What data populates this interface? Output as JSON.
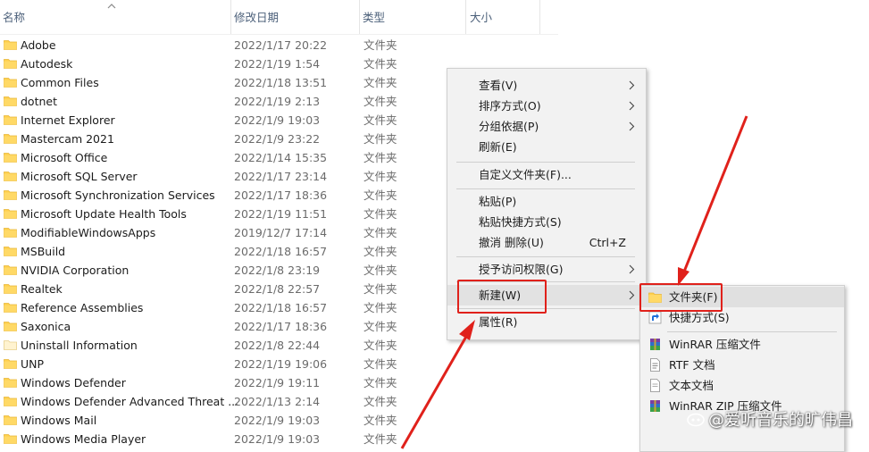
{
  "columns": {
    "name": "名称",
    "date": "修改日期",
    "type": "类型",
    "size": "大小"
  },
  "files": [
    {
      "name": "Adobe",
      "date": "2022/1/17 20:22",
      "type": "文件夹"
    },
    {
      "name": "Autodesk",
      "date": "2022/1/19 1:54",
      "type": "文件夹"
    },
    {
      "name": "Common Files",
      "date": "2022/1/18 13:51",
      "type": "文件夹"
    },
    {
      "name": "dotnet",
      "date": "2022/1/19 2:13",
      "type": "文件夹"
    },
    {
      "name": "Internet Explorer",
      "date": "2022/1/9 19:03",
      "type": "文件夹"
    },
    {
      "name": "Mastercam 2021",
      "date": "2022/1/9 23:22",
      "type": "文件夹"
    },
    {
      "name": "Microsoft Office",
      "date": "2022/1/14 15:35",
      "type": "文件夹"
    },
    {
      "name": "Microsoft SQL Server",
      "date": "2022/1/17 23:14",
      "type": "文件夹"
    },
    {
      "name": "Microsoft Synchronization Services",
      "date": "2022/1/17 18:36",
      "type": "文件夹"
    },
    {
      "name": "Microsoft Update Health Tools",
      "date": "2022/1/19 11:51",
      "type": "文件夹"
    },
    {
      "name": "ModifiableWindowsApps",
      "date": "2019/12/7 17:14",
      "type": "文件夹"
    },
    {
      "name": "MSBuild",
      "date": "2022/1/18 16:57",
      "type": "文件夹"
    },
    {
      "name": "NVIDIA Corporation",
      "date": "2022/1/8 23:19",
      "type": "文件夹"
    },
    {
      "name": "Realtek",
      "date": "2022/1/8 22:57",
      "type": "文件夹"
    },
    {
      "name": "Reference Assemblies",
      "date": "2022/1/18 16:57",
      "type": "文件夹"
    },
    {
      "name": "Saxonica",
      "date": "2022/1/17 18:36",
      "type": "文件夹"
    },
    {
      "name": "Uninstall Information",
      "date": "2022/1/8 22:44",
      "type": "文件夹"
    },
    {
      "name": "UNP",
      "date": "2022/1/19 19:06",
      "type": "文件夹"
    },
    {
      "name": "Windows Defender",
      "date": "2022/1/9 19:11",
      "type": "文件夹"
    },
    {
      "name": "Windows Defender Advanced Threat ...",
      "date": "2022/1/13 2:14",
      "type": "文件夹"
    },
    {
      "name": "Windows Mail",
      "date": "2022/1/9 19:03",
      "type": "文件夹"
    },
    {
      "name": "Windows Media Player",
      "date": "2022/1/9 19:03",
      "type": "文件夹"
    }
  ],
  "context_menu": {
    "view": "查看(V)",
    "sort": "排序方式(O)",
    "group": "分组依据(P)",
    "refresh": "刷新(E)",
    "customize": "自定义文件夹(F)...",
    "paste": "粘贴(P)",
    "paste_shortcut": "粘贴快捷方式(S)",
    "undo_delete": "撤消 删除(U)",
    "undo_shortcut": "Ctrl+Z",
    "grant_access": "授予访问权限(G)",
    "new": "新建(W)",
    "properties": "属性(R)"
  },
  "new_submenu": {
    "folder": "文件夹(F)",
    "shortcut": "快捷方式(S)",
    "winrar": "WinRAR 压缩文件",
    "rtf": "RTF 文档",
    "text": "文本文档",
    "winrar_zip": "WinRAR ZIP 压缩文件"
  },
  "watermark": "@爱听音乐的旷伟昌",
  "colors": {
    "folder_yellow": "#ffd04c",
    "folder_dark": "#e8b63a",
    "annotation_red": "#e0211b",
    "header_text": "#4c607a"
  }
}
